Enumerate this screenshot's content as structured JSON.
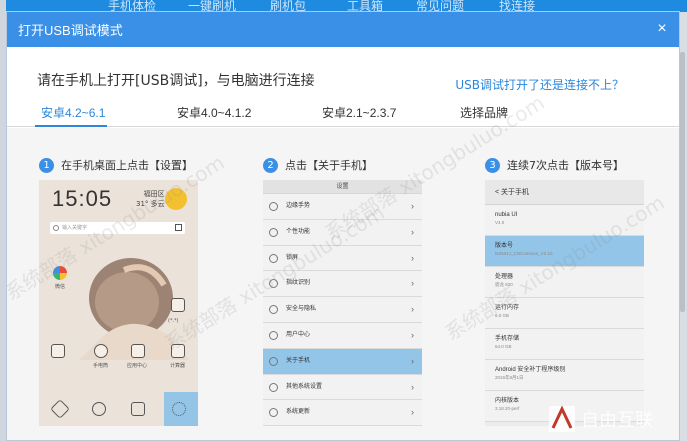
{
  "background_nav": {
    "items": [
      "手机体检",
      "一键刷机",
      "刷机包",
      "工具箱",
      "常见问题",
      "找连接"
    ]
  },
  "dialog": {
    "title": "打开USB调试模式",
    "close_label": "×",
    "instruction": "请在手机上打开[USB调试]，与电脑进行连接",
    "help_link": "USB调试打开了还是连接不上？",
    "tabs": [
      {
        "label": "安卓4.2~6.1",
        "active": true
      },
      {
        "label": "安卓4.0~4.1.2",
        "active": false
      },
      {
        "label": "安卓2.1~2.3.7",
        "active": false
      },
      {
        "label": "选择品牌",
        "active": false
      }
    ],
    "steps": [
      {
        "num": "1",
        "text": "在手机桌面上点击【设置】"
      },
      {
        "num": "2",
        "text": "点击【关于手机】"
      },
      {
        "num": "3",
        "text": "连续7次点击【版本号】"
      }
    ]
  },
  "phone1": {
    "time": "15:05",
    "city": "福田区",
    "temp": "31°  多云",
    "search_placeholder": "输入关键字",
    "app_wechat": "微信",
    "app_gallery": "(*.*)",
    "app_phone": "手电筒",
    "app_store": "应用中心",
    "app_calc": "计算器"
  },
  "phone2": {
    "title": "设置",
    "rows": [
      {
        "label": "边缘手势",
        "highlight": false
      },
      {
        "label": "个性功能",
        "highlight": false
      },
      {
        "label": "锁屏",
        "highlight": false
      },
      {
        "label": "指纹识别",
        "highlight": false
      },
      {
        "label": "安全与隐私",
        "highlight": false
      },
      {
        "label": "用户中心",
        "highlight": false
      },
      {
        "label": "关于手机",
        "highlight": true
      },
      {
        "label": "其他系统设置",
        "highlight": false
      },
      {
        "label": "系统更新",
        "highlight": false
      }
    ]
  },
  "phone3": {
    "title": "< 关于手机",
    "rows": [
      {
        "label": "nubia UI",
        "sub": "V4.0",
        "highlight": false
      },
      {
        "label": "版本号",
        "sub": "NX531J_CNCommon_V2.10",
        "highlight": true
      },
      {
        "label": "处理器",
        "sub": "骁龙 820",
        "highlight": false
      },
      {
        "label": "运行内存",
        "sub": "6.0 GB",
        "highlight": false
      },
      {
        "label": "手机存储",
        "sub": "64.0 GB",
        "highlight": false
      },
      {
        "label": "Android 安全补丁程序级别",
        "sub": "2016年8月1日",
        "highlight": false
      },
      {
        "label": "内核版本",
        "sub": "3.18.20-perf",
        "highlight": false
      }
    ]
  },
  "watermark_text": "系统部落 xitongbuluo.com",
  "logo_text": "自由互联"
}
